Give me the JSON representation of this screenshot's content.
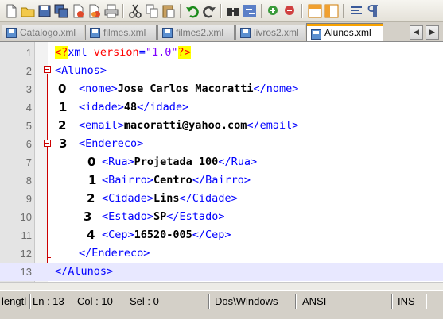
{
  "toolbar": {
    "buttons": [
      "new-file-icon",
      "open-file-icon",
      "save-icon",
      "save-all-icon",
      "close-icon",
      "close-all-icon",
      "print-icon",
      "cut-icon",
      "copy-icon",
      "paste-icon",
      "undo-icon",
      "redo-icon",
      "find-icon",
      "replace-icon",
      "zoom-in-icon",
      "zoom-out-icon",
      "sync-vertical-icon",
      "sync-horizontal-icon",
      "word-wrap-icon",
      "show-all-chars-icon"
    ]
  },
  "tabs": [
    {
      "label": "Catalogo.xml",
      "active": false
    },
    {
      "label": "filmes.xml",
      "active": false
    },
    {
      "label": "filmes2.xml",
      "active": false
    },
    {
      "label": "livros2.xml",
      "active": false
    },
    {
      "label": "Alunos.xml",
      "active": true
    }
  ],
  "editor": {
    "lines": [
      {
        "n": "1"
      },
      {
        "n": "2"
      },
      {
        "n": "3",
        "index_label": "0"
      },
      {
        "n": "4",
        "index_label": "1"
      },
      {
        "n": "5",
        "index_label": "2"
      },
      {
        "n": "6",
        "index_label": "3"
      },
      {
        "n": "7",
        "index_label": "0"
      },
      {
        "n": "8",
        "index_label": "1"
      },
      {
        "n": "9",
        "index_label": "2"
      },
      {
        "n": "10",
        "index_label": "3"
      },
      {
        "n": "11",
        "index_label": "4"
      },
      {
        "n": "12"
      },
      {
        "n": "13"
      }
    ],
    "xml": {
      "version": "1.0",
      "root": "Alunos",
      "nome": "Jose Carlos Macoratti",
      "idade": "48",
      "email": "macoratti@yahoo.com",
      "endereco_tag": "Endereco",
      "rua": "Projetada 100",
      "bairro": "Centro",
      "cidade": "Lins",
      "estado": "SP",
      "cep": "16520-005"
    }
  },
  "status": {
    "length": "lengtl",
    "ln": "Ln : 13",
    "col": "Col : 10",
    "sel": "Sel : 0",
    "eol": "Dos\\Windows",
    "encoding": "ANSI",
    "mode": "INS"
  },
  "colors": {
    "tag": "#0000ff",
    "attr": "#ff0000",
    "value": "#8000ff",
    "highlight": "#ffff00",
    "fold": "#cc0000"
  }
}
